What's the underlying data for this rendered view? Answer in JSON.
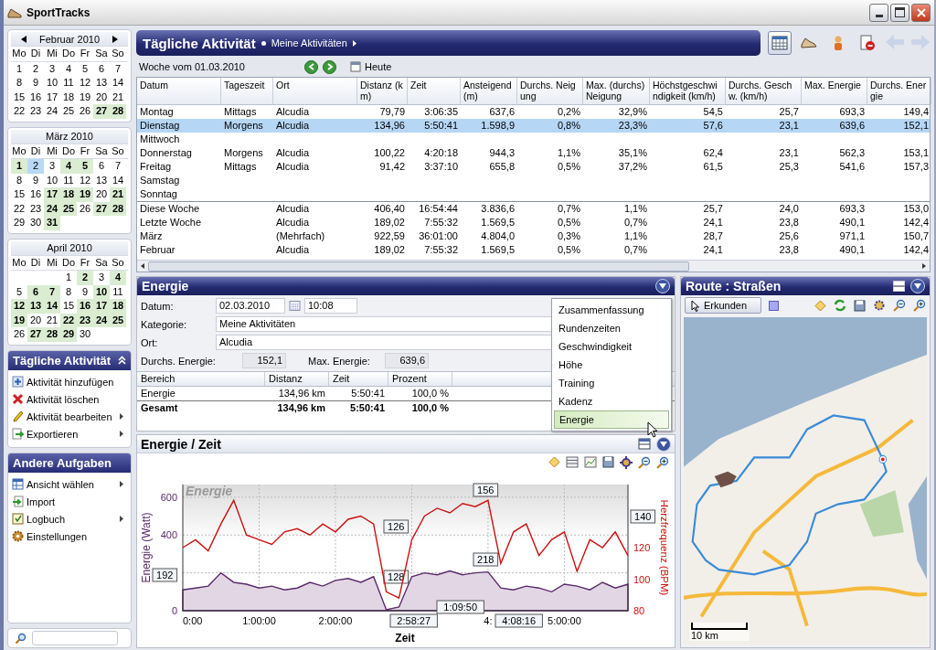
{
  "window": {
    "title": "SportTracks"
  },
  "calendars": [
    {
      "month": "Februar 2010",
      "nav": true,
      "weekdays": [
        "Mo",
        "Di",
        "Mi",
        "Do",
        "Fr",
        "Sa",
        "So"
      ],
      "weeks": [
        [
          {
            "day": "1",
            "active": false,
            "selected": false
          },
          {
            "day": "2",
            "active": false,
            "selected": false
          },
          {
            "day": "3",
            "active": false,
            "selected": false
          },
          {
            "day": "4",
            "active": false,
            "selected": false
          },
          {
            "day": "5",
            "active": false,
            "selected": false
          },
          {
            "day": "6",
            "active": false,
            "selected": false
          },
          {
            "day": "7",
            "active": false,
            "selected": false
          }
        ],
        [
          {
            "day": "8",
            "active": false,
            "selected": false
          },
          {
            "day": "9",
            "active": false,
            "selected": false
          },
          {
            "day": "10",
            "active": false,
            "selected": false
          },
          {
            "day": "11",
            "active": false,
            "selected": false
          },
          {
            "day": "12",
            "active": false,
            "selected": false
          },
          {
            "day": "13",
            "active": false,
            "selected": false
          },
          {
            "day": "14",
            "active": false,
            "selected": false
          }
        ],
        [
          {
            "day": "15",
            "active": false,
            "selected": false
          },
          {
            "day": "16",
            "active": false,
            "selected": false
          },
          {
            "day": "17",
            "active": false,
            "selected": false
          },
          {
            "day": "18",
            "active": false,
            "selected": false
          },
          {
            "day": "19",
            "active": false,
            "selected": false
          },
          {
            "day": "20",
            "active": false,
            "selected": false
          },
          {
            "day": "21",
            "active": false,
            "selected": false
          }
        ],
        [
          {
            "day": "22",
            "active": false,
            "selected": false
          },
          {
            "day": "23",
            "active": false,
            "selected": false
          },
          {
            "day": "24",
            "active": false,
            "selected": false
          },
          {
            "day": "25",
            "active": false,
            "selected": false
          },
          {
            "day": "26",
            "active": false,
            "selected": false
          },
          {
            "day": "27",
            "active": true,
            "selected": false
          },
          {
            "day": "28",
            "active": true,
            "selected": false
          }
        ]
      ]
    },
    {
      "month": "März 2010",
      "nav": false,
      "weekdays": [
        "Mo",
        "Di",
        "Mi",
        "Do",
        "Fr",
        "Sa",
        "So"
      ],
      "weeks": [
        [
          {
            "day": "1",
            "active": true,
            "selected": false
          },
          {
            "day": "2",
            "active": false,
            "selected": true
          },
          {
            "day": "3",
            "active": false,
            "selected": false
          },
          {
            "day": "4",
            "active": true,
            "selected": false
          },
          {
            "day": "5",
            "active": true,
            "selected": false
          },
          {
            "day": "6",
            "active": false,
            "selected": false
          },
          {
            "day": "7",
            "active": false,
            "selected": false
          }
        ],
        [
          {
            "day": "8",
            "active": false,
            "selected": false
          },
          {
            "day": "9",
            "active": false,
            "selected": false
          },
          {
            "day": "10",
            "active": false,
            "selected": false
          },
          {
            "day": "11",
            "active": false,
            "selected": false
          },
          {
            "day": "12",
            "active": false,
            "selected": false
          },
          {
            "day": "13",
            "active": false,
            "selected": false
          },
          {
            "day": "14",
            "active": false,
            "selected": false
          }
        ],
        [
          {
            "day": "15",
            "active": false,
            "selected": false
          },
          {
            "day": "16",
            "active": false,
            "selected": false
          },
          {
            "day": "17",
            "active": true,
            "selected": false
          },
          {
            "day": "18",
            "active": true,
            "selected": false
          },
          {
            "day": "19",
            "active": true,
            "selected": false
          },
          {
            "day": "20",
            "active": false,
            "selected": false
          },
          {
            "day": "21",
            "active": true,
            "selected": false
          }
        ],
        [
          {
            "day": "22",
            "active": false,
            "selected": false
          },
          {
            "day": "23",
            "active": false,
            "selected": false
          },
          {
            "day": "24",
            "active": true,
            "selected": false
          },
          {
            "day": "25",
            "active": true,
            "selected": false
          },
          {
            "day": "26",
            "active": false,
            "selected": false
          },
          {
            "day": "27",
            "active": true,
            "selected": false
          },
          {
            "day": "28",
            "active": true,
            "selected": false
          }
        ],
        [
          {
            "day": "29",
            "active": false,
            "selected": false
          },
          {
            "day": "30",
            "active": false,
            "selected": false
          },
          {
            "day": "31",
            "active": true,
            "selected": false
          }
        ]
      ]
    },
    {
      "month": "April 2010",
      "nav": false,
      "weekdays": [
        "Mo",
        "Di",
        "Mi",
        "Do",
        "Fr",
        "Sa",
        "So"
      ],
      "weeks": [
        [
          {
            "day": "1",
            "active": false,
            "selected": false
          },
          {
            "day": "2",
            "active": true,
            "selected": false
          },
          {
            "day": "3",
            "active": false,
            "selected": false
          },
          {
            "day": "4",
            "active": true,
            "selected": false
          }
        ],
        [
          {
            "day": "5",
            "active": false,
            "selected": false
          },
          {
            "day": "6",
            "active": true,
            "selected": false
          },
          {
            "day": "7",
            "active": true,
            "selected": false
          },
          {
            "day": "8",
            "active": false,
            "selected": false
          },
          {
            "day": "9",
            "active": false,
            "selected": false
          },
          {
            "day": "10",
            "active": true,
            "selected": false
          },
          {
            "day": "11",
            "active": false,
            "selected": false
          }
        ],
        [
          {
            "day": "12",
            "active": true,
            "selected": false
          },
          {
            "day": "13",
            "active": true,
            "selected": false
          },
          {
            "day": "14",
            "active": true,
            "selected": false
          },
          {
            "day": "15",
            "active": false,
            "selected": false
          },
          {
            "day": "16",
            "active": true,
            "selected": false
          },
          {
            "day": "17",
            "active": true,
            "selected": false
          },
          {
            "day": "18",
            "active": true,
            "selected": false
          }
        ],
        [
          {
            "day": "19",
            "active": true,
            "selected": false
          },
          {
            "day": "20",
            "active": false,
            "selected": false
          },
          {
            "day": "21",
            "active": false,
            "selected": false
          },
          {
            "day": "22",
            "active": true,
            "selected": false
          },
          {
            "day": "23",
            "active": true,
            "selected": false
          },
          {
            "day": "24",
            "active": true,
            "selected": false
          },
          {
            "day": "25",
            "active": true,
            "selected": false
          }
        ],
        [
          {
            "day": "26",
            "active": false,
            "selected": false
          },
          {
            "day": "27",
            "active": true,
            "selected": false
          },
          {
            "day": "28",
            "active": true,
            "selected": false
          },
          {
            "day": "29",
            "active": true,
            "selected": false
          },
          {
            "day": "30",
            "active": false,
            "selected": false
          }
        ]
      ]
    }
  ],
  "task_panels": [
    {
      "title": "Tägliche Aktivität",
      "collapse_button": true,
      "items": [
        {
          "label": "Aktivität hinzufügen",
          "submenu": false
        },
        {
          "label": "Aktivität löschen",
          "submenu": false
        },
        {
          "label": "Aktivität bearbeiten",
          "submenu": true
        },
        {
          "label": "Exportieren",
          "submenu": true
        }
      ]
    },
    {
      "title": "Andere Aufgaben",
      "collapse_button": false,
      "items": [
        {
          "label": "Ansicht wählen",
          "submenu": true
        },
        {
          "label": "Import",
          "submenu": false
        },
        {
          "label": "Logbuch",
          "submenu": true
        },
        {
          "label": "Einstellungen",
          "submenu": false
        }
      ]
    }
  ],
  "header": {
    "title": "Tägliche Aktivität",
    "subtitle": "Meine Aktivitäten"
  },
  "view_buttons": [
    {
      "selected": true
    },
    {
      "selected": false
    },
    {
      "selected": false
    },
    {
      "selected": false
    }
  ],
  "nav_buttons": [
    {
      "disabled": true
    },
    {
      "disabled": true
    }
  ],
  "week_bar": {
    "label": "Woche vom 01.03.2010",
    "today": "Heute"
  },
  "table": {
    "columns": [
      "Datum",
      "Tageszeit",
      "Ort",
      "Distanz (km)",
      "Zeit",
      "Ansteigend (m)",
      "Durchs. Neigung",
      "Max. (durchs) Neigung",
      "Höchstgeschwindigkeit (km/h)",
      "Durchs. Geschw. (km/h)",
      "Max. Energie",
      "Durchs. Energie"
    ],
    "rows": [
      {
        "selected": false,
        "cells": [
          "Montag",
          "Mittags",
          "Alcudia",
          "79,79",
          "3:06:35",
          "637,6",
          "0,2%",
          "32,9%",
          "54,5",
          "25,7",
          "693,3",
          "149,4"
        ]
      },
      {
        "selected": true,
        "cells": [
          "Dienstag",
          "Morgens",
          "Alcudia",
          "134,96",
          "5:50:41",
          "1.598,9",
          "0,8%",
          "23,3%",
          "57,6",
          "23,1",
          "639,6",
          "152,1"
        ]
      },
      {
        "selected": false,
        "cells": [
          "Mittwoch"
        ]
      },
      {
        "selected": false,
        "cells": [
          "Donnerstag",
          "Morgens",
          "Alcudia",
          "100,22",
          "4:20:18",
          "944,3",
          "1,1%",
          "35,1%",
          "62,4",
          "23,1",
          "562,3",
          "153,1"
        ]
      },
      {
        "selected": false,
        "cells": [
          "Freitag",
          "Mittags",
          "Alcudia",
          "91,42",
          "3:37:10",
          "655,8",
          "0,5%",
          "37,2%",
          "61,5",
          "25,3",
          "541,6",
          "157,3"
        ]
      },
      {
        "selected": false,
        "cells": [
          "Samstag"
        ]
      },
      {
        "selected": false,
        "cells": [
          "Sonntag"
        ]
      }
    ],
    "summary_rows": [
      {
        "selected": false,
        "cells": [
          "Diese Woche",
          "",
          "Alcudia",
          "406,40",
          "16:54:44",
          "3.836,6",
          "0,7%",
          "1,1%",
          "25,7",
          "24,0",
          "693,3",
          "153,0"
        ]
      },
      {
        "selected": false,
        "cells": [
          "Letzte Woche",
          "",
          "Alcudia",
          "189,02",
          "7:55:32",
          "1.569,5",
          "0,5%",
          "0,7%",
          "24,1",
          "23,8",
          "490,1",
          "142,4"
        ]
      },
      {
        "selected": false,
        "cells": [
          "März",
          "",
          "(Mehrfach)",
          "922,59",
          "36:01:00",
          "4.804,0",
          "0,3%",
          "1,1%",
          "28,7",
          "25,6",
          "971,1",
          "150,7"
        ]
      },
      {
        "selected": false,
        "cells": [
          "Februar",
          "",
          "Alcudia",
          "189,02",
          "7:55:32",
          "1.569,5",
          "0,5%",
          "0,7%",
          "24,1",
          "23,8",
          "490,1",
          "142,4"
        ]
      }
    ]
  },
  "energy_panel": {
    "title": "Energie",
    "date_label": "Datum:",
    "date": "02.03.2010",
    "time": "10:08",
    "category_label": "Kategorie:",
    "category": "Meine Aktivitäten",
    "place_label": "Ort:",
    "place": "Alcudia",
    "avg_label": "Durchs. Energie:",
    "avg": "152,1",
    "max_label": "Max. Energie:",
    "max": "639,6",
    "zones": {
      "columns": [
        "Bereich",
        "Distanz",
        "Zeit",
        "Prozent"
      ],
      "rows": [
        {
          "kind": "zone",
          "cells": [
            "Energie",
            "134,96 km",
            "5:50:41",
            "100,0 %"
          ]
        },
        {
          "kind": "total",
          "cells": [
            "Gesamt",
            "134,96 km",
            "5:50:41",
            "100,0 %"
          ]
        }
      ]
    },
    "menu": [
      {
        "label": "Zusammenfassung",
        "selected": false
      },
      {
        "label": "Rundenzeiten",
        "selected": false
      },
      {
        "label": "Geschwindigkeit",
        "selected": false
      },
      {
        "label": "Höhe",
        "selected": false
      },
      {
        "label": "Training",
        "selected": false
      },
      {
        "label": "Kadenz",
        "selected": false
      },
      {
        "label": "Energie",
        "selected": true
      }
    ]
  },
  "chart_panel": {
    "title": "Energie / Zeit",
    "tags": [
      "192",
      "140",
      "156",
      "126",
      "128",
      "218",
      "1:09:50",
      "2:58:27",
      "4:08:16"
    ],
    "covered_tick": "4:",
    "energy": {
      "chart_data": {
        "type": "area",
        "title": "Energie",
        "xlabel": "Zeit",
        "ylabel": "Energie (Watt)",
        "grid": true,
        "x": [
          0,
          10,
          20,
          30,
          40,
          50,
          60,
          70,
          80,
          90,
          100,
          110,
          120,
          130,
          140,
          150,
          160,
          170,
          180,
          190,
          200,
          210,
          220,
          230,
          240,
          250,
          260,
          270,
          280,
          290,
          300,
          310,
          320,
          330,
          340,
          350
        ],
        "xlim": [
          0,
          350
        ],
        "ylim": [
          0,
          667
        ],
        "xticks": [
          {
            "value": 0,
            "label": "0:00"
          },
          {
            "value": 60,
            "label": "1:00:00"
          },
          {
            "value": 120,
            "label": "2:00:00"
          },
          {
            "value": 300,
            "label": "5:00:00"
          }
        ],
        "yticks": [
          600,
          400,
          0
        ],
        "series": [
          {
            "color": "#5a2a6a",
            "values": [
              110,
              120,
              130,
              200,
              150,
              140,
              120,
              130,
              110,
              120,
              150,
              130,
              160,
              170,
              150,
              180,
              5,
              20,
              180,
              200,
              190,
              210,
              190,
              200,
              205,
              120,
              110,
              130,
              120,
              100,
              140,
              130,
              110,
              150,
              120,
              140
            ]
          }
        ]
      }
    },
    "heart_rate": {
      "chart_data": {
        "type": "line",
        "ylabel": "Herzfrequenz (BPM)",
        "x": [
          0,
          10,
          20,
          30,
          40,
          50,
          60,
          70,
          80,
          90,
          100,
          110,
          120,
          130,
          140,
          150,
          160,
          170,
          180,
          190,
          200,
          210,
          220,
          230,
          240,
          250,
          260,
          270,
          280,
          290,
          300,
          310,
          320,
          330,
          340,
          350
        ],
        "xlim": [
          0,
          350
        ],
        "ylim": [
          80,
          160
        ],
        "yticks": [
          120,
          100,
          80
        ],
        "series": [
          {
            "color": "#cc1010",
            "values": [
              120,
              125,
              118,
              135,
              150,
              128,
              125,
              122,
              130,
              132,
              128,
              135,
              130,
              138,
              140,
              135,
              92,
              88,
              125,
              140,
              145,
              142,
              148,
              146,
              150,
              110,
              130,
              135,
              115,
              125,
              130,
              105,
              125,
              120,
              130,
              115
            ]
          }
        ]
      }
    }
  },
  "map_panel": {
    "title": "Route : Straßen",
    "explore": "Erkunden",
    "scale": "10 km"
  }
}
